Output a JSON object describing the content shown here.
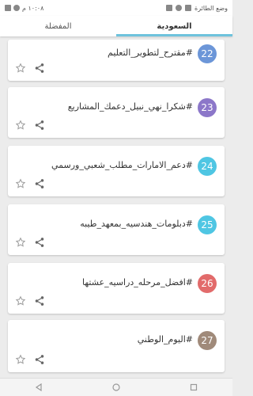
{
  "status_bar": {
    "time": "١٠:٠٨ م",
    "notification_text": "وضع الطائرة"
  },
  "tabs": [
    {
      "label": "السعودية",
      "active": true
    },
    {
      "label": "المفضلة",
      "active": false
    }
  ],
  "items": [
    {
      "number": "22",
      "title": "#مقترح_لتطوير_التعليم",
      "color": "#6c96d8"
    },
    {
      "number": "23",
      "title": "#شكرا_نهي_نبيل_دعمك_المشاريع",
      "color": "#8c77c9"
    },
    {
      "number": "24",
      "title": "#دعم_الامارات_مطلب_شعبي_ورسمي",
      "color": "#4fc6e3"
    },
    {
      "number": "25",
      "title": "#دبلومات_هندسيه_بمعهد_طيبه",
      "color": "#4fc6e3"
    },
    {
      "number": "26",
      "title": "#افضل_مرحله_دراسيه_عشتها",
      "color": "#e26b6b"
    },
    {
      "number": "27",
      "title": "#اليوم_الوطني",
      "color": "#a08a7a"
    }
  ],
  "icons": {
    "share": "share-icon",
    "favorite": "star-outline-icon"
  }
}
